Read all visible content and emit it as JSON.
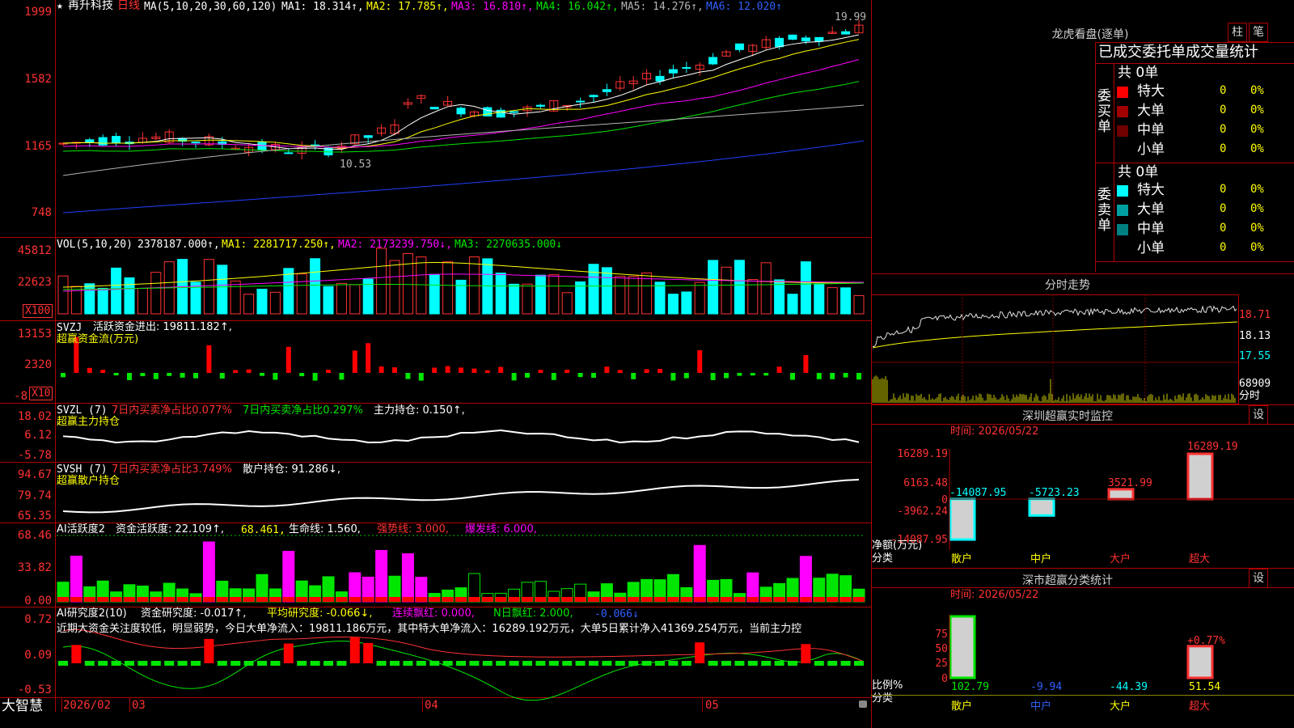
{
  "main_chart": {
    "star": "★",
    "stock_name": "再升科技",
    "period": "日线",
    "ma_params": "MA(5,10,20,30,60,120)",
    "ma1": "MA1: 18.314↑,",
    "ma2": "MA2: 17.785↑,",
    "ma3": "MA3: 16.810↑,",
    "ma4": "MA4: 16.042↑,",
    "ma5": "MA5: 14.276↑,",
    "ma6": "MA6: 12.020↑",
    "y_ticks": [
      "1999",
      "1582",
      "1165",
      "748"
    ],
    "high_label": "19.99",
    "low_label": "10.53",
    "colors": {
      "up": "#ff3232",
      "down": "#00ffff",
      "ma1": "#ffffff",
      "ma2": "#ffff00",
      "ma3": "#ff00ff",
      "ma4": "#00e600",
      "ma5": "#b4b4b4",
      "ma6": "#2040ff"
    }
  },
  "vol_panel": {
    "title": "VOL(5,10,20)",
    "value": "2378187.000↑,",
    "ma1": "MA1: 2281717.250↑,",
    "ma2": "MA2: 2173239.750↓,",
    "ma3": "MA3: 2270635.000↓",
    "y_ticks": [
      "45812",
      "22623"
    ],
    "unit": "X100"
  },
  "svzj_panel": {
    "title": "SVZJ",
    "line1": "活跃资金进出: 19811.182↑,",
    "line2": "超赢资金流(万元)",
    "y_ticks": [
      "13153",
      "2320",
      "-8"
    ],
    "unit": "X10"
  },
  "svzl_panel": {
    "title": "SVZL (7)",
    "a": "7日内买卖净占比0.077%",
    "b": "7日内买卖净占比0.297%",
    "c": "主力持仓: 0.150↑,",
    "line2": "超赢主力持仓",
    "y_ticks": [
      "18.02",
      "6.12",
      "-5.78"
    ]
  },
  "svsh_panel": {
    "title": "SVSH (7)",
    "a": "7日内买卖净占比3.749%",
    "b": "散户持仓: 91.286↓,",
    "line2": "超赢散户持仓",
    "y_ticks": [
      "94.67",
      "79.74",
      "65.35"
    ]
  },
  "ai2_panel": {
    "title": "AI活跃度2",
    "a": "资金活跃度: 22.109↑,",
    "b": "68.461,",
    "c": "生命线: 1.560,",
    "d": "强势线: 3.000,",
    "e": "爆发线: 6.000,",
    "y_ticks": [
      "68.46",
      "33.82",
      "0.00"
    ]
  },
  "ai_research_panel": {
    "title": "AI研究度2(10)",
    "a": "资金研究度: -0.017↑,",
    "b": "平均研究度: -0.066↓,",
    "c": "连续飘红: 0.000,",
    "d": "N日飘红: 2.000,",
    "e": "-0.066↓",
    "comment": "近期大资金关注度较低，明显弱势，今日大单净流入：19811.186万元，其中特大单净流入：16289.192万元，大单5日累计净入41369.254万元，当前主力控",
    "y_ticks": [
      "0.72",
      "0.09",
      "-0.53"
    ]
  },
  "bottom_bar": {
    "brand": "大智慧",
    "date_start": "2026/02",
    "months": [
      "03",
      "04",
      "05"
    ]
  },
  "lhb_panel": {
    "title": "龙虎看盘(逐单)",
    "btn_column": "柱",
    "btn_stroke": "笔",
    "header": "已成交委托单成交量统计",
    "buy_label": "委买单",
    "sell_label": "委卖单",
    "buy_total": "共 0单",
    "sell_total": "共 0单",
    "buy_rows": [
      {
        "name": "特大",
        "count": "0",
        "pct": "0%",
        "color": "#ff0000"
      },
      {
        "name": "大单",
        "count": "0",
        "pct": "0%",
        "color": "#a00000"
      },
      {
        "name": "中单",
        "count": "0",
        "pct": "0%",
        "color": "#700000"
      },
      {
        "name": "小单",
        "count": "0",
        "pct": "0%",
        "color": "#000000"
      }
    ],
    "sell_rows": [
      {
        "name": "特大",
        "count": "0",
        "pct": "0%",
        "color": "#00ffff"
      },
      {
        "name": "大单",
        "count": "0",
        "pct": "0%",
        "color": "#00a0a0"
      },
      {
        "name": "中单",
        "count": "0",
        "pct": "0%",
        "color": "#008080"
      },
      {
        "name": "小单",
        "count": "0",
        "pct": "0%",
        "color": "#000000"
      }
    ]
  },
  "intraday_panel": {
    "title": "分时走势",
    "y_ticks": [
      "18.71",
      "18.13",
      "17.55"
    ],
    "vol_tick": "68909",
    "vol_label": "分时"
  },
  "sz_monitor": {
    "title": "深圳超赢实时监控",
    "btn": "设",
    "time": "时间: 2026/05/22",
    "y_ticks": [
      "16289.19",
      "6163.48",
      "0",
      "-3962.24",
      "-14087.95"
    ],
    "y_label_1": "净额(万元)",
    "y_label_2": "分类",
    "categories": [
      "散户",
      "中户",
      "大户",
      "超大"
    ],
    "values": [
      -14087.95,
      -5723.23,
      3521.99,
      16289.19
    ],
    "value_labels": [
      "-14087.95",
      "-5723.23",
      "3521.99",
      "16289.19"
    ]
  },
  "sz_classify": {
    "title": "深市超赢分类统计",
    "btn": "设",
    "time": "时间: 2026/05/22",
    "y_ticks": [
      "75",
      "50",
      "25",
      "0"
    ],
    "y_label_1": "比例%",
    "y_label_2": "分类",
    "categories": [
      "散户",
      "中户",
      "大户",
      "超大"
    ],
    "values": [
      102.79,
      -9.94,
      -44.39,
      51.54
    ],
    "value_labels": [
      "102.79",
      "-9.94",
      "-44.39",
      "51.54"
    ],
    "extra_label": "+0.77%"
  }
}
